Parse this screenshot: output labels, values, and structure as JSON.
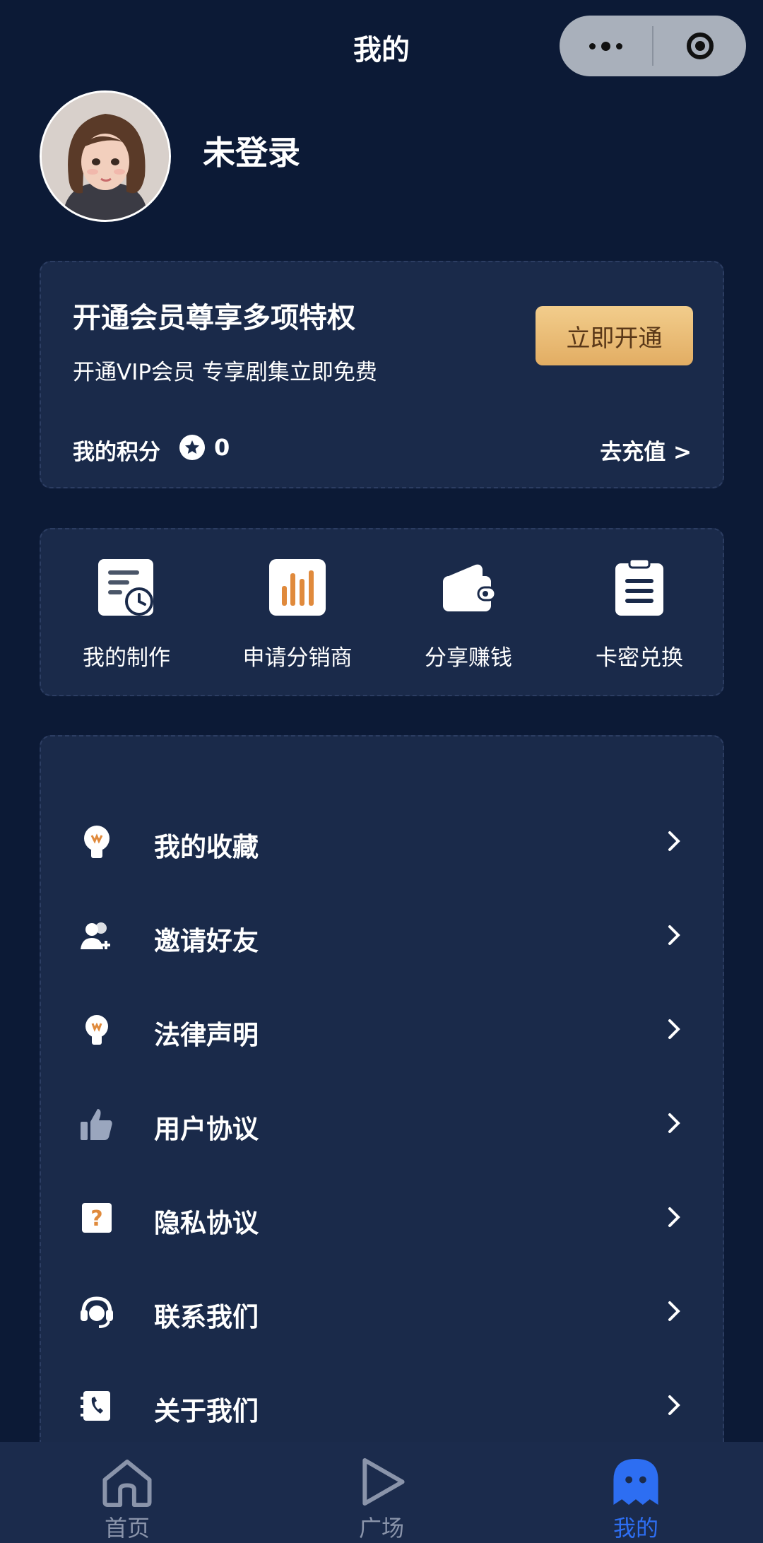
{
  "header": {
    "title": "我的"
  },
  "profile": {
    "username": "未登录"
  },
  "vip": {
    "title": "开通会员尊享多项特权",
    "subtitle": "开通VIP会员 专享剧集立即免费",
    "button_label": "立即开通",
    "points_label": "我的积分",
    "points_value": "0",
    "recharge_label": "去充值 >"
  },
  "quick_actions": [
    {
      "label": "我的制作",
      "icon": "document-clock-icon"
    },
    {
      "label": "申请分销商",
      "icon": "bar-chart-icon"
    },
    {
      "label": "分享赚钱",
      "icon": "wallet-icon"
    },
    {
      "label": "卡密兑换",
      "icon": "clipboard-icon"
    }
  ],
  "menu": [
    {
      "label": "我的收藏",
      "icon": "lightbulb-icon"
    },
    {
      "label": "邀请好友",
      "icon": "add-friend-icon"
    },
    {
      "label": "法律声明",
      "icon": "lightbulb-icon"
    },
    {
      "label": "用户协议",
      "icon": "thumbs-up-icon"
    },
    {
      "label": "隐私协议",
      "icon": "question-icon"
    },
    {
      "label": "联系我们",
      "icon": "headset-icon"
    },
    {
      "label": "关于我们",
      "icon": "phone-book-icon"
    }
  ],
  "tabbar": [
    {
      "label": "首页",
      "icon": "home-icon",
      "active": false
    },
    {
      "label": "广场",
      "icon": "play-icon",
      "active": false
    },
    {
      "label": "我的",
      "icon": "ghost-icon",
      "active": true
    }
  ],
  "colors": {
    "background": "#0c1a36",
    "card": "#1a2a4a",
    "accent_gold": "#e9bc73",
    "accent_orange": "#e08a3c",
    "active_tab": "#2d6ef2",
    "inactive_tab": "#8a94aa"
  }
}
